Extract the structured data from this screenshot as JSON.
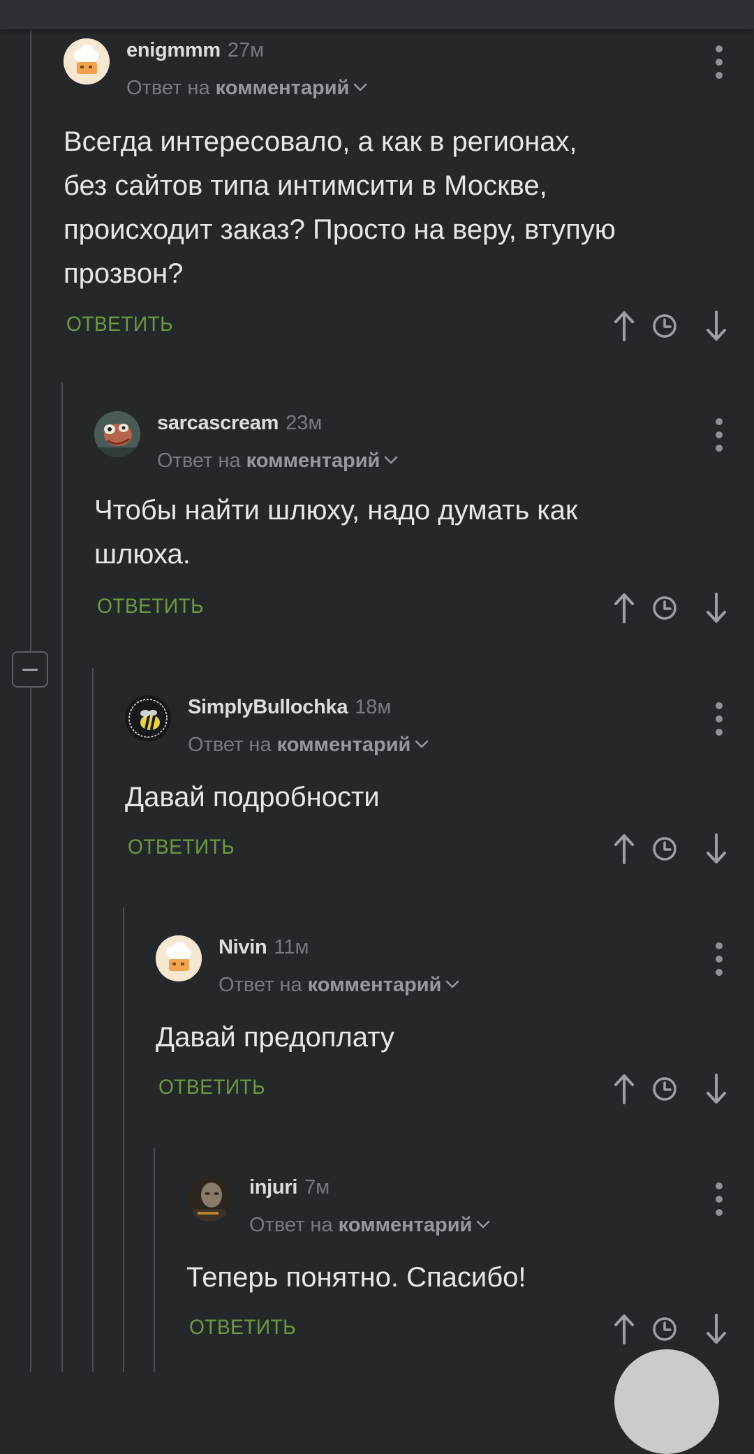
{
  "comments": [
    {
      "username": "enigmmm",
      "time": "27м",
      "reply_prefix": "Ответ на",
      "reply_target": "комментарий",
      "text_lines": [
        "Всегда интересовало, а как в регионах,",
        "без сайтов типа интимсити в Москве,",
        "происходит заказ? Просто на веру, втупую",
        "прозвон?"
      ],
      "reply_label": "ОТВЕТИТЬ",
      "avatar": "chef-hat-avatar"
    },
    {
      "username": "sarcascream",
      "time": "23м",
      "reply_prefix": "Ответ на",
      "reply_target": "комментарий",
      "text_lines": [
        "Чтобы найти шлюху, надо думать как",
        "шлюха."
      ],
      "reply_label": "ОТВЕТИТЬ",
      "avatar": "creature-avatar"
    },
    {
      "username": "SimplyBullochka",
      "time": "18м",
      "reply_prefix": "Ответ на",
      "reply_target": "комментарий",
      "text_lines": [
        "Давай подробности"
      ],
      "reply_label": "ОТВЕТИТЬ",
      "avatar": "bee-avatar"
    },
    {
      "username": "Nivin",
      "time": "11м",
      "reply_prefix": "Ответ на",
      "reply_target": "комментарий",
      "text_lines": [
        "Давай предоплату"
      ],
      "reply_label": "ОТВЕТИТЬ",
      "avatar": "chef-hat-avatar"
    },
    {
      "username": "injuri",
      "time": "7м",
      "reply_prefix": "Ответ на",
      "reply_target": "комментарий",
      "text_lines": [
        "Теперь понятно. Спасибо!"
      ],
      "reply_label": "ОТВЕТИТЬ",
      "avatar": "portrait-avatar"
    }
  ],
  "icons": {
    "upvote": "arrow-up-icon",
    "history": "clock-icon",
    "downvote": "arrow-down-icon",
    "menu": "kebab-menu-icon",
    "expand": "chevron-down-icon",
    "collapse": "minus-icon"
  },
  "colors": {
    "background": "#25282b",
    "accent_green": "#6c9a3e",
    "muted_text": "#777b80"
  }
}
